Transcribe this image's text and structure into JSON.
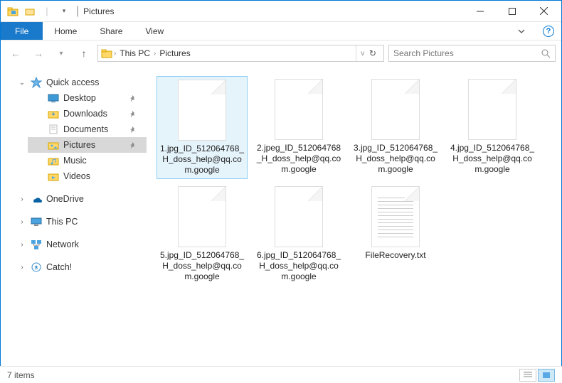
{
  "window": {
    "title": "Pictures"
  },
  "ribbon": {
    "file": "File",
    "tabs": [
      "Home",
      "Share",
      "View"
    ]
  },
  "breadcrumb": {
    "items": [
      "This PC",
      "Pictures"
    ]
  },
  "search": {
    "placeholder": "Search Pictures"
  },
  "nav": {
    "quick_access": {
      "label": "Quick access",
      "items": [
        {
          "label": "Desktop",
          "pinned": true,
          "icon": "desktop"
        },
        {
          "label": "Downloads",
          "pinned": true,
          "icon": "downloads"
        },
        {
          "label": "Documents",
          "pinned": true,
          "icon": "documents"
        },
        {
          "label": "Pictures",
          "pinned": true,
          "icon": "pictures",
          "selected": true
        },
        {
          "label": "Music",
          "pinned": false,
          "icon": "music"
        },
        {
          "label": "Videos",
          "pinned": false,
          "icon": "videos"
        }
      ]
    },
    "roots": [
      {
        "label": "OneDrive",
        "icon": "onedrive"
      },
      {
        "label": "This PC",
        "icon": "thispc"
      },
      {
        "label": "Network",
        "icon": "network"
      },
      {
        "label": "Catch!",
        "icon": "catch"
      }
    ]
  },
  "files": [
    {
      "name": "1.jpg_ID_512064768_H_doss_help@qq.com.google",
      "type": "blank",
      "selected": true
    },
    {
      "name": "2.jpeg_ID_512064768_H_doss_help@qq.com.google",
      "type": "blank"
    },
    {
      "name": "3.jpg_ID_512064768_H_doss_help@qq.com.google",
      "type": "blank"
    },
    {
      "name": "4.jpg_ID_512064768_H_doss_help@qq.com.google",
      "type": "blank"
    },
    {
      "name": "5.jpg_ID_512064768_H_doss_help@qq.com.google",
      "type": "blank"
    },
    {
      "name": "6.jpg_ID_512064768_H_doss_help@qq.com.google",
      "type": "blank"
    },
    {
      "name": "FileRecovery.txt",
      "type": "txt"
    }
  ],
  "status": {
    "count": "7 items"
  }
}
